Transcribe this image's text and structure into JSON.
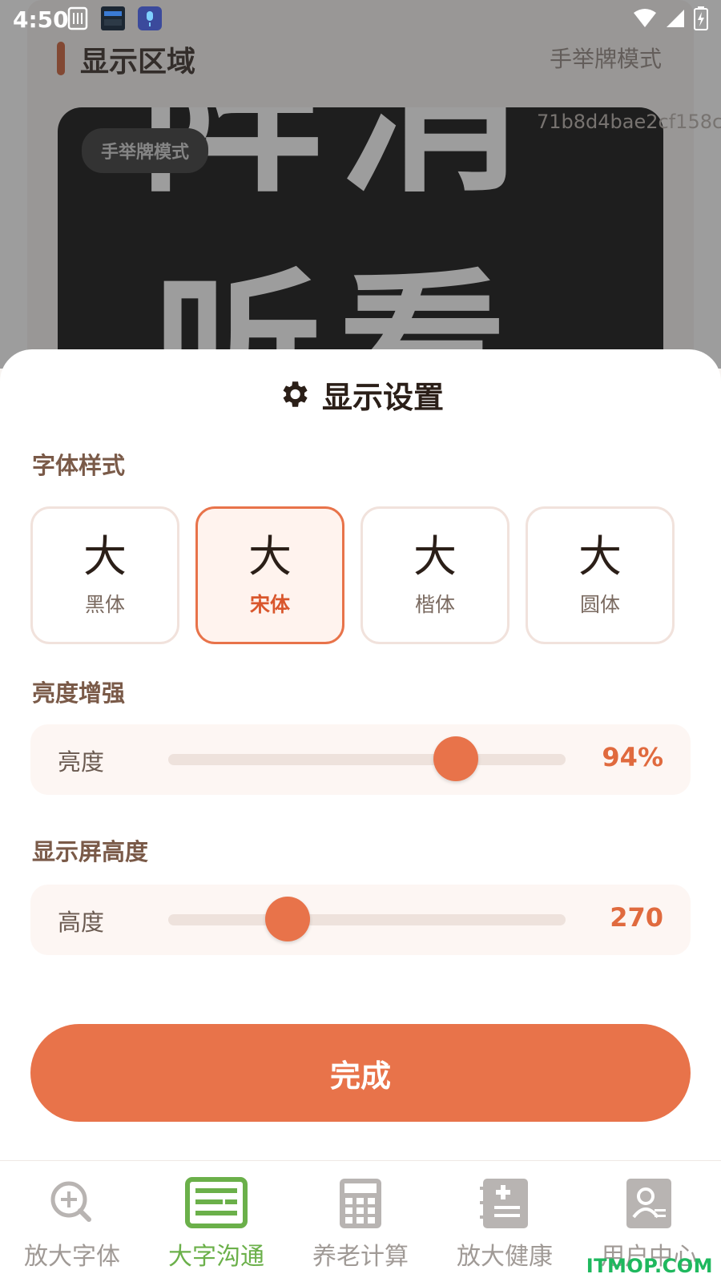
{
  "status_bar": {
    "time": "4:50"
  },
  "background": {
    "section_title": "显示区域",
    "mode_label": "手举牌模式",
    "chip_label": "手举牌模式",
    "code_text": "71b8d4bae2cf158c",
    "big_text_line1": "阵消",
    "big_text_line2": "听看"
  },
  "sheet": {
    "title": "显示设置",
    "font_section": {
      "label": "字体样式",
      "options": [
        {
          "char": "大",
          "label": "黑体",
          "selected": false
        },
        {
          "char": "大",
          "label": "宋体",
          "selected": true
        },
        {
          "char": "大",
          "label": "楷体",
          "selected": false
        },
        {
          "char": "大",
          "label": "圆体",
          "selected": false
        }
      ]
    },
    "brightness": {
      "section_label": "亮度增强",
      "label": "亮度",
      "value_text": "94%",
      "value": 94
    },
    "height": {
      "section_label": "显示屏高度",
      "label": "高度",
      "value_text": "270",
      "slider_fraction": 0.3
    },
    "done_label": "完成"
  },
  "bottom_nav": {
    "items": [
      {
        "label": "放大字体",
        "icon": "zoom-in-icon",
        "active": false
      },
      {
        "label": "大字沟通",
        "icon": "message-lines-icon",
        "active": true
      },
      {
        "label": "养老计算",
        "icon": "calculator-icon",
        "active": false
      },
      {
        "label": "放大健康",
        "icon": "health-book-icon",
        "active": false
      },
      {
        "label": "用户中心",
        "icon": "user-card-icon",
        "active": false
      }
    ]
  },
  "watermark": "ITMOP.COM",
  "colors": {
    "accent": "#e8734a",
    "nav_active": "#6bb04a",
    "title": "#2b1f18"
  }
}
